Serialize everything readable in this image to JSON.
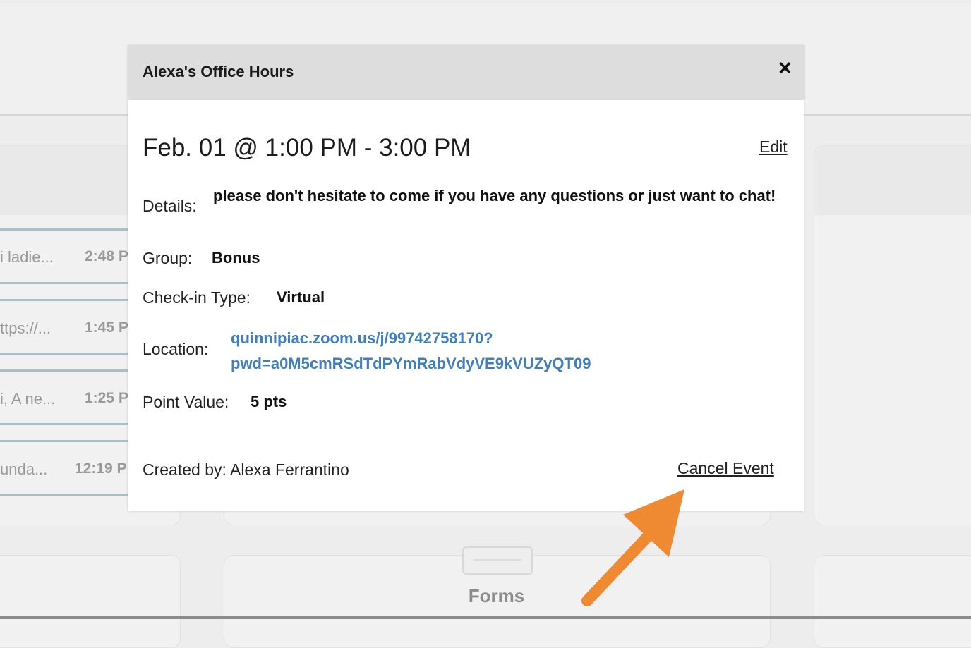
{
  "background": {
    "messages": [
      {
        "snippet": "i ladie...",
        "time": "2:48 P"
      },
      {
        "snippet": "ttps://...",
        "time": "1:45 P"
      },
      {
        "snippet": "i, A ne...",
        "time": "1:25 P"
      },
      {
        "snippet": "unda...",
        "time": "12:19 P"
      }
    ],
    "forms_label": "Forms"
  },
  "modal": {
    "title": "Alexa's Office Hours",
    "close_symbol": "×",
    "datetime": "Feb. 01 @ 1:00 PM - 3:00 PM",
    "edit_label": "Edit",
    "details_label": "Details:",
    "details_value": "please don't hesitate to come if you have any questions or just want to chat!",
    "group_label": "Group:",
    "group_value": "Bonus",
    "checkin_label": "Check-in Type:",
    "checkin_value": "Virtual",
    "location_label": "Location:",
    "location_line1": "quinnipiac.zoom.us/j/99742758170?",
    "location_line2": "pwd=a0M5cmRSdTdPYmRabVdyVE9kVUZyQT09",
    "points_label": "Point Value:",
    "points_value": "5 pts",
    "created_by": "Created by: Alexa Ferrantino",
    "cancel_label": "Cancel Event"
  },
  "annotation": {
    "arrow_color": "#ef8a32"
  }
}
